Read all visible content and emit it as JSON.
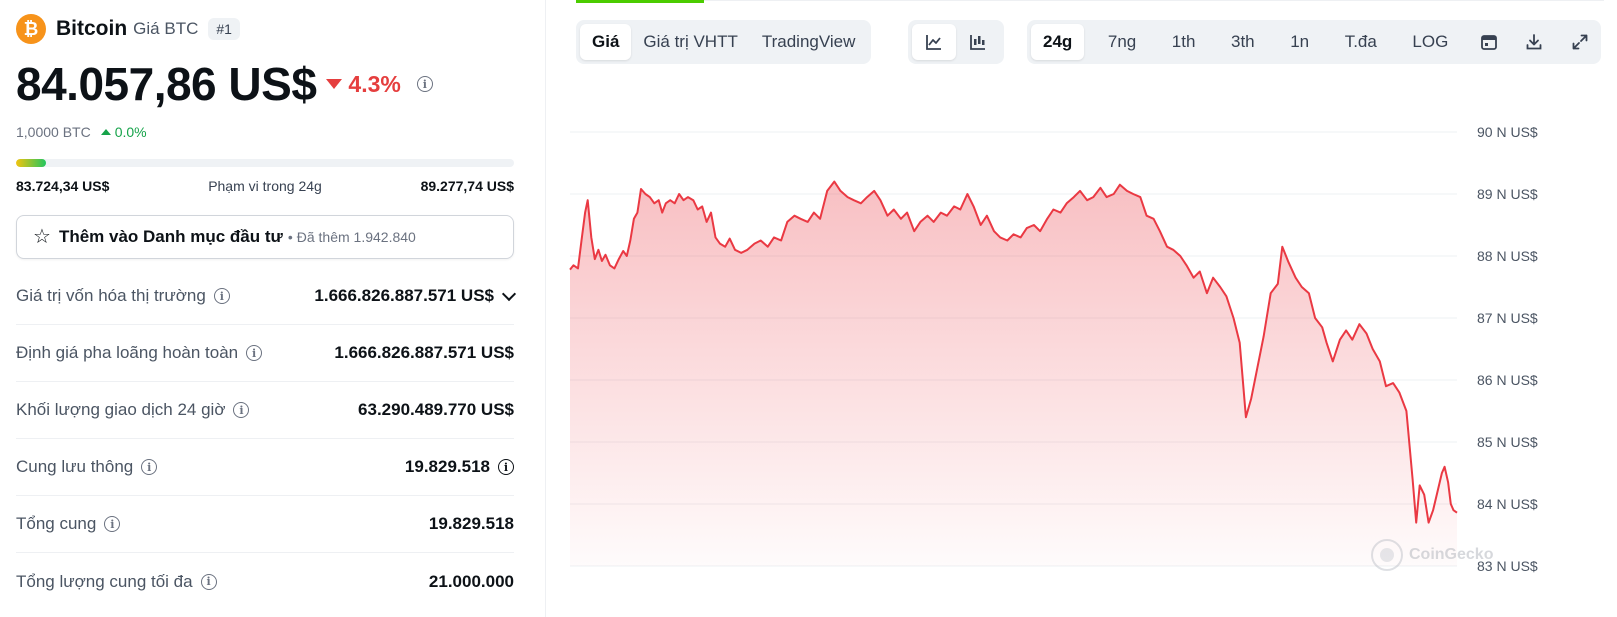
{
  "coin": {
    "logo_symbol": "₿",
    "name": "Bitcoin",
    "subtitle": "Giá BTC",
    "rank": "#1"
  },
  "price": {
    "value": "84.057,86 US$",
    "change": "4.3%",
    "change_direction": "down",
    "btc_value": "1,0000 BTC",
    "btc_change": "0.0%",
    "btc_change_direction": "up"
  },
  "range": {
    "low": "83.724,34 US$",
    "label": "Phạm vi trong 24g",
    "high": "89.277,74 US$",
    "position_fraction": 0.06
  },
  "watchlist": {
    "label": "Thêm vào Danh mục đầu tư",
    "separator": "•",
    "added_text": "Đã thêm 1.942.840"
  },
  "stats": [
    {
      "label": "Giá trị vốn hóa thị trường",
      "value": "1.666.826.887.571 US$"
    },
    {
      "label": "Định giá pha loãng hoàn toàn",
      "value": "1.666.826.887.571 US$"
    },
    {
      "label": "Khối lượng giao dịch 24 giờ",
      "value": "63.290.489.770 US$"
    },
    {
      "label": "Cung lưu thông",
      "value": "19.829.518"
    },
    {
      "label": "Tổng cung",
      "value": "19.829.518"
    },
    {
      "label": "Tổng lượng cung tối đa",
      "value": "21.000.000"
    }
  ],
  "chart_tabs": {
    "data_tabs": [
      {
        "label": "Giá",
        "active": true
      },
      {
        "label": "Giá trị VHTT",
        "active": false
      },
      {
        "label": "TradingView",
        "active": false
      }
    ],
    "chart_types": [
      {
        "icon": "line-chart-icon",
        "active": true
      },
      {
        "icon": "candlestick-chart-icon",
        "active": false
      }
    ],
    "ranges": [
      {
        "label": "24g",
        "active": true
      },
      {
        "label": "7ng",
        "active": false
      },
      {
        "label": "1th",
        "active": false
      },
      {
        "label": "3th",
        "active": false
      },
      {
        "label": "1n",
        "active": false
      },
      {
        "label": "T.đa",
        "active": false
      },
      {
        "label": "LOG",
        "active": false
      }
    ],
    "tools": [
      "calendar-icon",
      "download-icon",
      "fullscreen-icon"
    ]
  },
  "chart_data": {
    "type": "area",
    "ylim": [
      83,
      90
    ],
    "y_ticks": [
      90,
      89,
      88,
      87,
      86,
      85,
      84,
      83
    ],
    "y_tick_labels": [
      "90 N US$",
      "89 N US$",
      "88 N US$",
      "87 N US$",
      "86 N US$",
      "85 N US$",
      "84 N US$",
      "83 N US$"
    ],
    "grid": true,
    "legend": "none",
    "line_color": "#ea3943",
    "fill_color": "#ea3943",
    "watermark": "CoinGecko",
    "x_range": [
      0,
      100
    ],
    "points": [
      [
        0.0,
        87.78
      ],
      [
        0.4,
        87.85
      ],
      [
        0.9,
        87.8
      ],
      [
        1.3,
        88.25
      ],
      [
        1.7,
        88.7
      ],
      [
        2.0,
        88.9
      ],
      [
        2.4,
        88.3
      ],
      [
        2.8,
        87.95
      ],
      [
        3.2,
        88.1
      ],
      [
        3.6,
        87.92
      ],
      [
        4.0,
        88.02
      ],
      [
        4.5,
        87.85
      ],
      [
        5.0,
        87.8
      ],
      [
        5.5,
        87.95
      ],
      [
        6.0,
        88.08
      ],
      [
        6.4,
        88.0
      ],
      [
        6.8,
        88.25
      ],
      [
        7.2,
        88.6
      ],
      [
        7.6,
        88.7
      ],
      [
        8.0,
        89.08
      ],
      [
        8.5,
        89.0
      ],
      [
        9.0,
        88.95
      ],
      [
        9.5,
        88.85
      ],
      [
        10.0,
        88.9
      ],
      [
        10.4,
        88.7
      ],
      [
        10.8,
        88.85
      ],
      [
        11.3,
        88.9
      ],
      [
        11.8,
        88.85
      ],
      [
        12.3,
        89.0
      ],
      [
        12.8,
        88.9
      ],
      [
        13.3,
        88.95
      ],
      [
        13.9,
        88.9
      ],
      [
        14.4,
        88.75
      ],
      [
        14.9,
        88.8
      ],
      [
        15.4,
        88.55
      ],
      [
        15.9,
        88.7
      ],
      [
        16.4,
        88.3
      ],
      [
        16.9,
        88.2
      ],
      [
        17.5,
        88.15
      ],
      [
        18.0,
        88.28
      ],
      [
        18.6,
        88.1
      ],
      [
        19.3,
        88.05
      ],
      [
        20.0,
        88.1
      ],
      [
        20.8,
        88.2
      ],
      [
        21.5,
        88.25
      ],
      [
        22.3,
        88.15
      ],
      [
        23.0,
        88.3
      ],
      [
        23.8,
        88.25
      ],
      [
        24.5,
        88.55
      ],
      [
        25.3,
        88.65
      ],
      [
        26.0,
        88.6
      ],
      [
        26.8,
        88.55
      ],
      [
        27.5,
        88.7
      ],
      [
        28.2,
        88.6
      ],
      [
        29.0,
        89.05
      ],
      [
        29.8,
        89.2
      ],
      [
        30.5,
        89.05
      ],
      [
        31.3,
        88.95
      ],
      [
        32.0,
        88.9
      ],
      [
        32.8,
        88.85
      ],
      [
        33.5,
        88.95
      ],
      [
        34.3,
        89.05
      ],
      [
        35.0,
        88.9
      ],
      [
        35.8,
        88.65
      ],
      [
        36.5,
        88.75
      ],
      [
        37.3,
        88.6
      ],
      [
        38.0,
        88.7
      ],
      [
        38.8,
        88.4
      ],
      [
        39.5,
        88.55
      ],
      [
        40.3,
        88.65
      ],
      [
        41.0,
        88.55
      ],
      [
        41.8,
        88.7
      ],
      [
        42.5,
        88.65
      ],
      [
        43.3,
        88.8
      ],
      [
        44.0,
        88.75
      ],
      [
        44.8,
        89.0
      ],
      [
        45.5,
        88.8
      ],
      [
        46.3,
        88.5
      ],
      [
        47.0,
        88.65
      ],
      [
        47.8,
        88.4
      ],
      [
        48.5,
        88.3
      ],
      [
        49.3,
        88.25
      ],
      [
        50.0,
        88.35
      ],
      [
        50.8,
        88.3
      ],
      [
        51.5,
        88.45
      ],
      [
        52.3,
        88.5
      ],
      [
        53.0,
        88.4
      ],
      [
        53.8,
        88.6
      ],
      [
        54.5,
        88.75
      ],
      [
        55.3,
        88.7
      ],
      [
        56.0,
        88.85
      ],
      [
        56.8,
        88.95
      ],
      [
        57.5,
        89.05
      ],
      [
        58.3,
        88.9
      ],
      [
        59.0,
        88.95
      ],
      [
        59.8,
        89.1
      ],
      [
        60.5,
        88.95
      ],
      [
        61.3,
        89.0
      ],
      [
        62.0,
        89.15
      ],
      [
        62.8,
        89.05
      ],
      [
        63.5,
        89.0
      ],
      [
        64.3,
        88.95
      ],
      [
        65.0,
        88.65
      ],
      [
        65.8,
        88.6
      ],
      [
        66.5,
        88.4
      ],
      [
        67.3,
        88.15
      ],
      [
        68.0,
        88.1
      ],
      [
        68.8,
        88.0
      ],
      [
        69.5,
        87.85
      ],
      [
        70.3,
        87.65
      ],
      [
        71.0,
        87.75
      ],
      [
        71.8,
        87.4
      ],
      [
        72.5,
        87.65
      ],
      [
        73.3,
        87.5
      ],
      [
        74.0,
        87.35
      ],
      [
        74.8,
        87.0
      ],
      [
        75.5,
        86.6
      ],
      [
        76.2,
        85.4
      ],
      [
        76.8,
        85.7
      ],
      [
        77.5,
        86.2
      ],
      [
        78.2,
        86.7
      ],
      [
        79.0,
        87.4
      ],
      [
        79.8,
        87.55
      ],
      [
        80.3,
        88.15
      ],
      [
        81.0,
        87.9
      ],
      [
        81.8,
        87.65
      ],
      [
        82.5,
        87.5
      ],
      [
        83.3,
        87.4
      ],
      [
        84.0,
        87.0
      ],
      [
        84.8,
        86.85
      ],
      [
        85.3,
        86.6
      ],
      [
        86.0,
        86.3
      ],
      [
        86.8,
        86.65
      ],
      [
        87.5,
        86.8
      ],
      [
        88.2,
        86.65
      ],
      [
        89.0,
        86.9
      ],
      [
        89.8,
        86.75
      ],
      [
        90.5,
        86.5
      ],
      [
        91.3,
        86.3
      ],
      [
        92.0,
        85.9
      ],
      [
        92.8,
        85.95
      ],
      [
        93.5,
        85.8
      ],
      [
        94.3,
        85.5
      ],
      [
        95.0,
        84.4
      ],
      [
        95.4,
        83.7
      ],
      [
        95.8,
        84.3
      ],
      [
        96.3,
        84.15
      ],
      [
        96.8,
        83.7
      ],
      [
        97.3,
        83.9
      ],
      [
        97.8,
        84.2
      ],
      [
        98.3,
        84.5
      ],
      [
        98.6,
        84.6
      ],
      [
        99.0,
        84.35
      ],
      [
        99.3,
        84.0
      ],
      [
        99.6,
        83.9
      ],
      [
        100.0,
        83.86
      ]
    ]
  }
}
